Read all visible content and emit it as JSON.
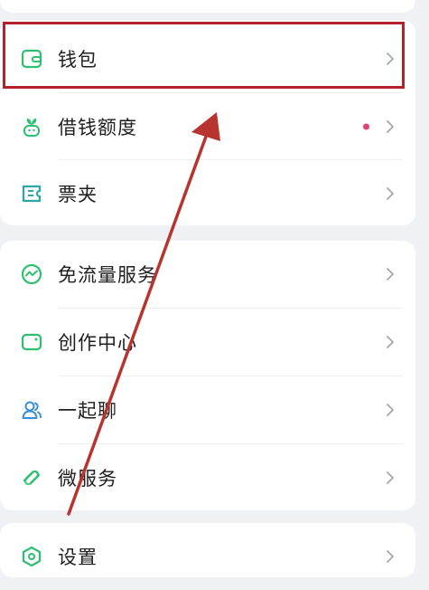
{
  "menu": {
    "group1": [
      {
        "label": "钱包",
        "icon": "wallet-icon",
        "badge_dot": false
      },
      {
        "label": "借钱额度",
        "icon": "sprout-icon",
        "badge_dot": true
      },
      {
        "label": "票夹",
        "icon": "ticket-icon",
        "badge_dot": false
      }
    ],
    "group2": [
      {
        "label": "免流量服务",
        "icon": "data-wave-icon",
        "badge_dot": false
      },
      {
        "label": "创作中心",
        "icon": "creator-camera-icon",
        "badge_dot": false
      },
      {
        "label": "一起聊",
        "icon": "chat-people-icon",
        "badge_dot": false
      },
      {
        "label": "微服务",
        "icon": "link-service-icon",
        "badge_dot": false
      }
    ],
    "group3": [
      {
        "label": "设置",
        "icon": "settings-icon",
        "badge_dot": false
      }
    ]
  },
  "colors": {
    "icon_green": "#2fbf71",
    "highlight": "#b3222a",
    "badge_dot": "#e0457a",
    "arrow": "#b8342f"
  }
}
